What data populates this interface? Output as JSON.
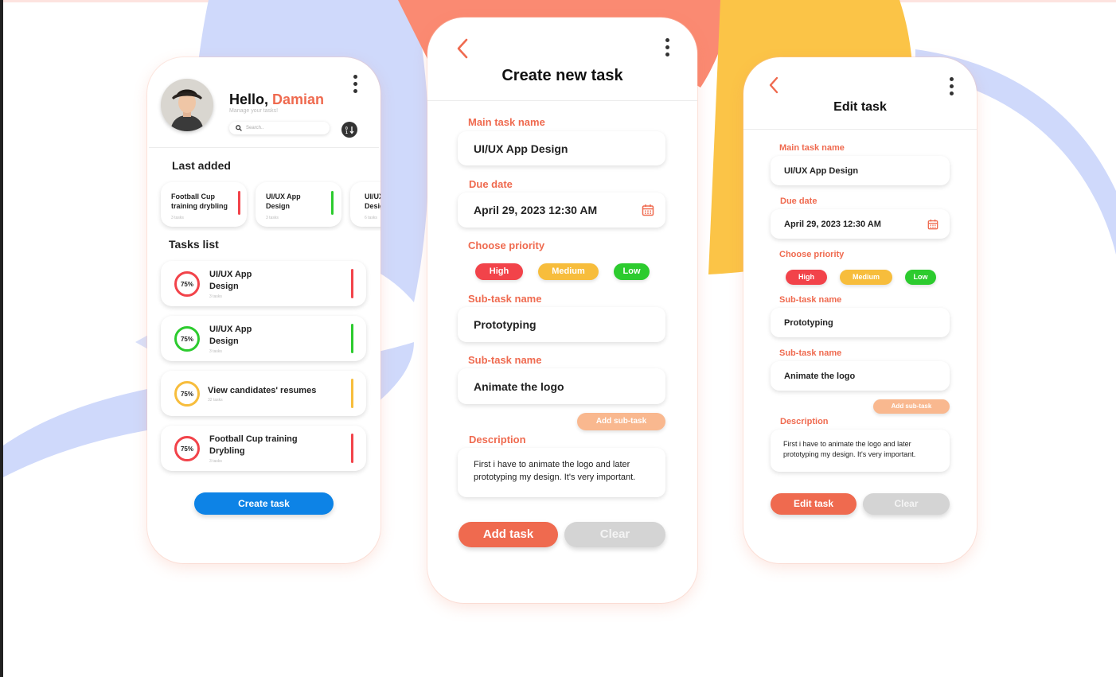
{
  "colors": {
    "accent": "#ef6a4f",
    "high": "#f2434a",
    "medium": "#f7bd3c",
    "low": "#2ccb2e",
    "blue": "#0d83e6",
    "clear": "#d4d4d4",
    "addsub": "#f9b88f"
  },
  "home": {
    "greeting": "Hello,",
    "name": "Damian",
    "subtitle": "Manage your tasks!",
    "search_placeholder": "Search..",
    "last_added_title": "Last added",
    "last_added": [
      {
        "title": "Football Cup training drybling",
        "count": "3 tasks",
        "color": "#f2434a"
      },
      {
        "title": "UI/UX App Design",
        "count": "3 tasks",
        "color": "#2ccb2e"
      },
      {
        "title": "UI/UX App Design",
        "count": "6 tasks",
        "color": "#f7bd3c"
      }
    ],
    "tasks_title": "Tasks list",
    "tasks": [
      {
        "percent": "75%",
        "title": "UI/UX App Design",
        "count": "3 tasks",
        "color": "#f2434a"
      },
      {
        "percent": "75%",
        "title": "UI/UX App Design",
        "count": "3 tasks",
        "color": "#2ccb2e"
      },
      {
        "percent": "75%",
        "title": "View candidates' resumes",
        "count": "32 tasks",
        "color": "#f7bd3c"
      },
      {
        "percent": "75%",
        "title": "Football Cup training Drybling",
        "count": "3 tasks",
        "color": "#f2434a"
      }
    ],
    "create_button": "Create task"
  },
  "create": {
    "title": "Create new task",
    "main_label": "Main task name",
    "main_value": "UI/UX App Design",
    "due_label": "Due date",
    "due_value": "April 29, 2023 12:30 AM",
    "priority_label": "Choose priority",
    "priority": {
      "high": "High",
      "medium": "Medium",
      "low": "Low"
    },
    "sub1_label": "Sub-task name",
    "sub1_value": "Prototyping",
    "sub2_label": "Sub-task name",
    "sub2_value": "Animate the logo",
    "add_sub": "Add sub-task",
    "desc_label": "Description",
    "desc_value": "First i have to animate the logo and later prototyping my design. It's very important.",
    "submit": "Add task",
    "clear": "Clear"
  },
  "edit": {
    "title": "Edit task",
    "main_label": "Main task name",
    "main_value": "UI/UX App Design",
    "due_label": "Due date",
    "due_value": "April 29, 2023 12:30 AM",
    "priority_label": "Choose priority",
    "priority": {
      "high": "High",
      "medium": "Medium",
      "low": "Low"
    },
    "sub1_label": "Sub-task name",
    "sub1_value": "Prototyping",
    "sub2_label": "Sub-task name",
    "sub2_value": "Animate the logo",
    "add_sub": "Add sub-task",
    "desc_label": "Description",
    "desc_value": "First i have to animate the logo and later prototyping my design. It's very important.",
    "submit": "Edit task",
    "clear": "Clear"
  }
}
